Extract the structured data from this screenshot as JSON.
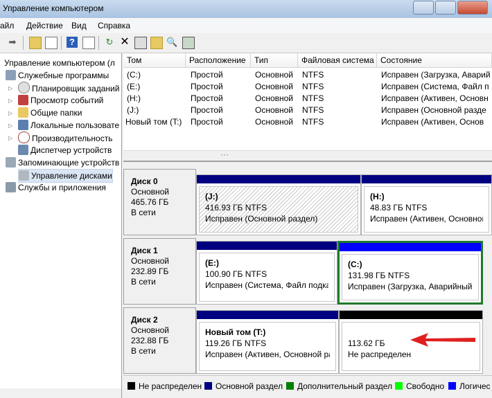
{
  "window": {
    "title": "Управление компьютером"
  },
  "menu": [
    "айл",
    "Действие",
    "Вид",
    "Справка"
  ],
  "toolbar": {
    "icons": [
      "back-arrow-icon",
      "up-folder-icon",
      "show-tree-icon",
      "help-icon",
      "properties-view-icon",
      "refresh-icon",
      "delete-icon",
      "properties-icon",
      "open-folder-icon",
      "search-icon",
      "wizard-icon"
    ]
  },
  "tree": {
    "root": "Управление компьютером (л",
    "items": [
      {
        "label": "Служебные программы",
        "icon": "tools-icon"
      },
      {
        "label": "Планировщик заданий",
        "icon": "clock-icon"
      },
      {
        "label": "Просмотр событий",
        "icon": "event-viewer-icon"
      },
      {
        "label": "Общие папки",
        "icon": "shared-folder-icon"
      },
      {
        "label": "Локальные пользовате",
        "icon": "users-icon"
      },
      {
        "label": "Производительность",
        "icon": "performance-icon"
      },
      {
        "label": "Диспетчер устройств",
        "icon": "device-manager-icon"
      },
      {
        "label": "Запоминающие устройств",
        "icon": "storage-icon"
      },
      {
        "label": "Управление дисками",
        "icon": "disk-management-icon"
      },
      {
        "label": "Службы и приложения",
        "icon": "services-icon"
      }
    ]
  },
  "volumes": {
    "columns": [
      "Том",
      "Расположение",
      "Тип",
      "Файловая система",
      "Состояние"
    ],
    "rows": [
      [
        "(C:)",
        "Простой",
        "Основной",
        "NTFS",
        "Исправен (Загрузка, Аварий"
      ],
      [
        "(E:)",
        "Простой",
        "Основной",
        "NTFS",
        "Исправен (Система, Файл п"
      ],
      [
        "(H:)",
        "Простой",
        "Основной",
        "NTFS",
        "Исправен (Активен, Основн"
      ],
      [
        "(J:)",
        "Простой",
        "Основной",
        "NTFS",
        "Исправен (Основной разде"
      ],
      [
        "Новый том (T:)",
        "Простой",
        "Основной",
        "NTFS",
        "Исправен (Активен, Основ"
      ]
    ],
    "scroll_dots": "···"
  },
  "disks": [
    {
      "name": "Диск 0",
      "type": "Основной",
      "size": "465.76 ГБ",
      "status": "В сети",
      "partitions": [
        {
          "label": "(J:)",
          "size": "416.93 ГБ NTFS",
          "state": "Исправен (Основной раздел)"
        },
        {
          "label": "(H:)",
          "size": "48.83 ГБ NTFS",
          "state": "Исправен (Активен, Основной"
        }
      ]
    },
    {
      "name": "Диск 1",
      "type": "Основной",
      "size": "232.89 ГБ",
      "status": "В сети",
      "partitions": [
        {
          "label": "(E:)",
          "size": "100.90 ГБ NTFS",
          "state": "Исправен (Система, Файл подкачк"
        },
        {
          "label": "(C:)",
          "size": "131.98 ГБ NTFS",
          "state": "Исправен (Загрузка, Аварийный д"
        }
      ]
    },
    {
      "name": "Диск 2",
      "type": "Основной",
      "size": "232.88 ГБ",
      "status": "В сети",
      "partitions": [
        {
          "label": "Новый том  (T:)",
          "size": "119.26 ГБ NTFS",
          "state": "Исправен (Активен, Основной разд"
        },
        {
          "label": "",
          "size": "113.62 ГБ",
          "state": "Не распределен"
        }
      ]
    }
  ],
  "legend": [
    {
      "label": "Не распределен",
      "color": "#000000"
    },
    {
      "label": "Основной раздел",
      "color": "#000080"
    },
    {
      "label": "Дополнительный раздел",
      "color": "#008000"
    },
    {
      "label": "Свободно",
      "color": "#00ff00"
    },
    {
      "label": "Логичес",
      "color": "#0000ff"
    }
  ],
  "colors": {
    "primary_bar": "#000080",
    "selected_bar": "#0000ff",
    "unallocated_bar": "#000000",
    "selection_border": "#1f7a2a",
    "arrow": "#e02020"
  }
}
